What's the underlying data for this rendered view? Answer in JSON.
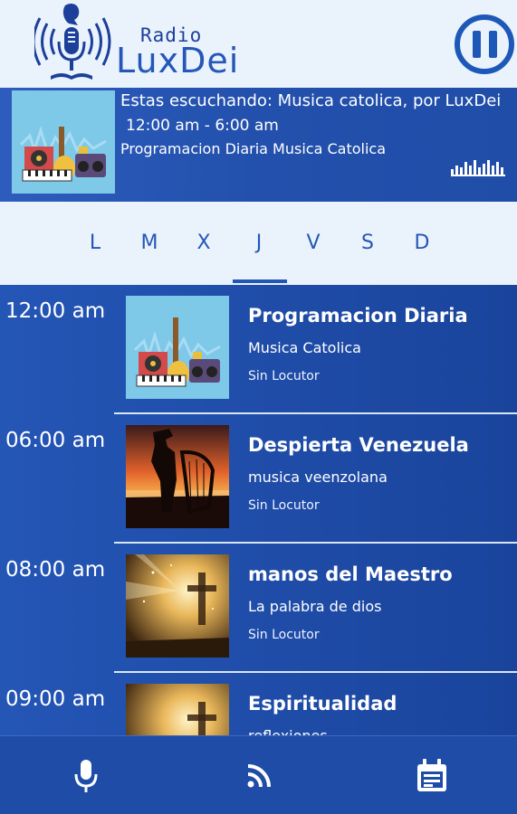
{
  "header": {
    "logo_radio": "Radio",
    "logo_name": "LuxDei",
    "pause_icon": "pause-icon"
  },
  "now_playing": {
    "line1": "Estas escuchando: Musica catolica, por LuxDei",
    "time": "12:00 am - 6:00 am",
    "program": "Programacion Diaria  Musica Catolica",
    "equalizer_icon": "equalizer-icon"
  },
  "days": {
    "items": [
      "L",
      "M",
      "X",
      "J",
      "V",
      "S",
      "D"
    ],
    "selected": "J"
  },
  "schedule": [
    {
      "time": "12:00 am",
      "title": "Programacion Diaria",
      "subtitle": "Musica Catolica",
      "host": "Sin Locutor",
      "image": "instruments-image"
    },
    {
      "time": "06:00 am",
      "title": "Despierta  Venezuela",
      "subtitle": "musica veenzolana",
      "host": "Sin Locutor",
      "image": "harp-player-sunset-image"
    },
    {
      "time": "08:00 am",
      "title": " manos  del Maestro",
      "subtitle": "La palabra de dios",
      "host": "Sin Locutor",
      "image": "cross-light-image"
    },
    {
      "time": "09:00 am",
      "title": "Espiritualidad",
      "subtitle": "reflexiones",
      "host": "",
      "image": "cross-light-image"
    }
  ],
  "bottom_nav": {
    "items": [
      "microphone-icon",
      "rss-icon",
      "calendar-icon"
    ]
  },
  "colors": {
    "header_bg": "#eaf3fc",
    "accent": "#2357b7",
    "panel_blue": "#1f4da8"
  }
}
